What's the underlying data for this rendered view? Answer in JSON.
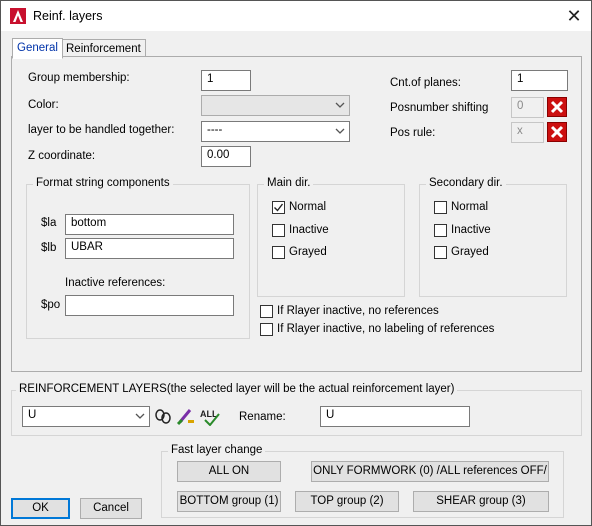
{
  "window": {
    "title": "Reinf. layers",
    "app_icon": "autocad-logo"
  },
  "tabs": [
    {
      "label": "General",
      "active": true
    },
    {
      "label": "Reinforcement",
      "active": false
    }
  ],
  "general": {
    "group_membership": {
      "label": "Group membership:",
      "value": "1"
    },
    "color": {
      "label": "Color:",
      "value": ""
    },
    "layer_together": {
      "label": "layer to be handled together:",
      "value": "----"
    },
    "z_coordinate": {
      "label": "Z coordinate:",
      "value": "0.00"
    },
    "cnt_planes": {
      "label": "Cnt.of planes:",
      "value": "1"
    },
    "posnumber_shifting": {
      "label": "Posnumber shifting",
      "value": "0"
    },
    "pos_rule": {
      "label": "Pos rule:",
      "value": "x"
    }
  },
  "format_group": {
    "title": "Format string components",
    "la_label": "$la",
    "la_value": "bottom",
    "lb_label": "$lb",
    "lb_value": "UBAR",
    "inactive_refs_label": "Inactive references:",
    "po_label": "$po",
    "po_value": ""
  },
  "main_dir": {
    "title": "Main dir.",
    "options": [
      {
        "label": "Normal",
        "checked": true
      },
      {
        "label": "Inactive",
        "checked": false
      },
      {
        "label": "Grayed",
        "checked": false
      }
    ]
  },
  "secondary_dir": {
    "title": "Secondary dir.",
    "options": [
      {
        "label": "Normal",
        "checked": false
      },
      {
        "label": "Inactive",
        "checked": false
      },
      {
        "label": "Grayed",
        "checked": false
      }
    ]
  },
  "rlayer_options": [
    {
      "label": "If Rlayer inactive, no references",
      "checked": false
    },
    {
      "label": "If Rlayer inactive, no labeling of references",
      "checked": false
    }
  ],
  "reinf_layers": {
    "title": "REINFORCEMENT LAYERS(the selected layer will be the actual reinforcement layer)",
    "selected": "U",
    "rename_label": "Rename:",
    "rename_value": "U"
  },
  "fast_layer": {
    "title": "Fast layer change",
    "all_on": "ALL ON",
    "only_formwork": "ONLY FORMWORK (0) /ALL references OFF/",
    "bottom_group": "BOTTOM group (1)",
    "top_group": "TOP group (2)",
    "shear_group": "SHEAR group (3)"
  },
  "buttons": {
    "ok": "OK",
    "cancel": "Cancel"
  },
  "colors": {
    "accent": "#0078d7",
    "tab_active_text": "#0033aa",
    "x_button": "#cc1010"
  }
}
